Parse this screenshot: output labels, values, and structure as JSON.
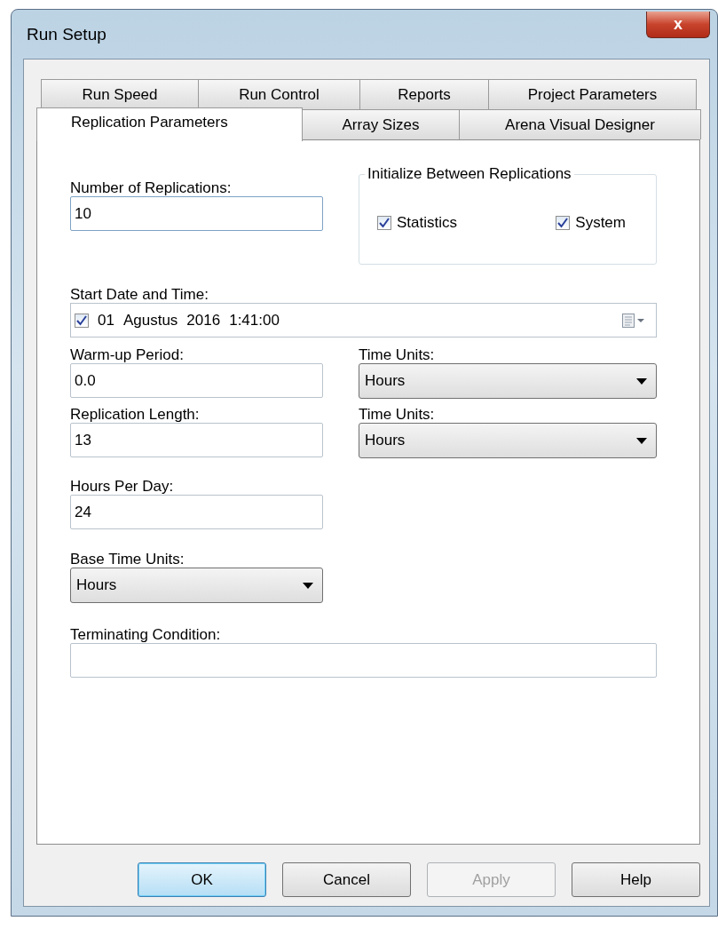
{
  "window": {
    "title": "Run Setup",
    "close": "x"
  },
  "tab_rows": [
    [
      {
        "label": "Run Speed",
        "selected": false
      },
      {
        "label": "Run Control",
        "selected": false
      },
      {
        "label": "Reports",
        "selected": false
      },
      {
        "label": "Project Parameters",
        "selected": false
      }
    ],
    [
      {
        "label": "Replication Parameters",
        "selected": true
      },
      {
        "label": "Array Sizes",
        "selected": false
      },
      {
        "label": "Arena Visual Designer",
        "selected": false
      }
    ]
  ],
  "number_of_replications": {
    "label": "Number of Replications:",
    "value": "10"
  },
  "initialize_group": {
    "title": "Initialize Between Replications",
    "options": [
      {
        "label": "Statistics",
        "checked": true
      },
      {
        "label": "System",
        "checked": true
      }
    ]
  },
  "start_date": {
    "label": "Start Date and Time:",
    "checked": true,
    "parts": [
      "01",
      "Agustus",
      "2016",
      "1:41:00"
    ]
  },
  "warm_up_period": {
    "label": "Warm-up Period:",
    "value": "0.0"
  },
  "warm_up_units": {
    "label": "Time Units:",
    "value": "Hours"
  },
  "replication_length": {
    "label": "Replication Length:",
    "value": "13"
  },
  "replication_units": {
    "label": "Time Units:",
    "value": "Hours"
  },
  "hours_per_day": {
    "label": "Hours Per Day:",
    "value": "24"
  },
  "base_time_units": {
    "label": "Base Time Units:",
    "value": "Hours"
  },
  "terminating_condition": {
    "label": "Terminating Condition:"
  },
  "buttons": [
    {
      "label": "OK",
      "kind": "default",
      "disabled": false
    },
    {
      "label": "Cancel",
      "kind": "normal",
      "disabled": false
    },
    {
      "label": "Apply",
      "kind": "normal",
      "disabled": true
    },
    {
      "label": "Help",
      "kind": "normal",
      "disabled": false
    }
  ]
}
